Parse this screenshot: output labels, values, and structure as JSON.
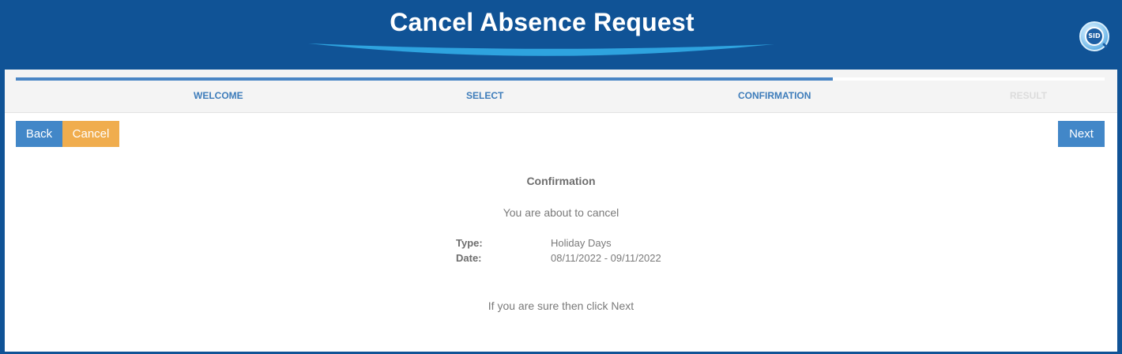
{
  "header": {
    "title": "Cancel Absence Request",
    "logo_text": "SID"
  },
  "wizard": {
    "progress_percent": 75,
    "steps": [
      {
        "label": "WELCOME",
        "state": "complete"
      },
      {
        "label": "SELECT",
        "state": "complete"
      },
      {
        "label": "CONFIRMATION",
        "state": "current"
      },
      {
        "label": "RESULT",
        "state": "pending"
      }
    ]
  },
  "buttons": {
    "back": "Back",
    "cancel": "Cancel",
    "next": "Next"
  },
  "confirmation": {
    "heading": "Confirmation",
    "intro": "You are about to cancel",
    "type_label": "Type:",
    "type_value": "Holiday Days",
    "date_label": "Date:",
    "date_value": "08/11/2022 - 09/11/2022",
    "footer": "If you are sure then click Next"
  },
  "colors": {
    "brand_blue": "#105396",
    "button_blue": "#4287c8",
    "button_orange": "#f0ad4e"
  }
}
